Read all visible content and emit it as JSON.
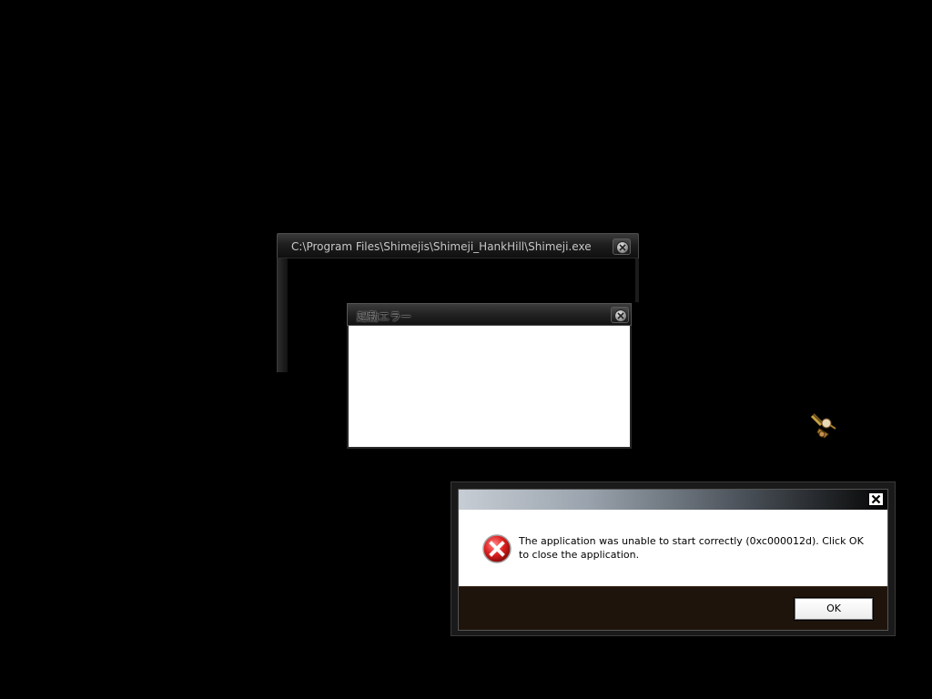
{
  "console_window": {
    "title": "C:\\Program Files\\Shimejis\\Shimeji_HankHill\\Shimeji.exe"
  },
  "startup_error_window": {
    "title": "起動エラー"
  },
  "error_dialog": {
    "message": "The application was unable to start correctly (0xc000012d). Click OK to close the application.",
    "ok_label": "OK",
    "icon": "error-icon"
  },
  "desktop": {
    "background_color": "#000000",
    "shimeji_icon": "shimeji-figure-icon"
  }
}
